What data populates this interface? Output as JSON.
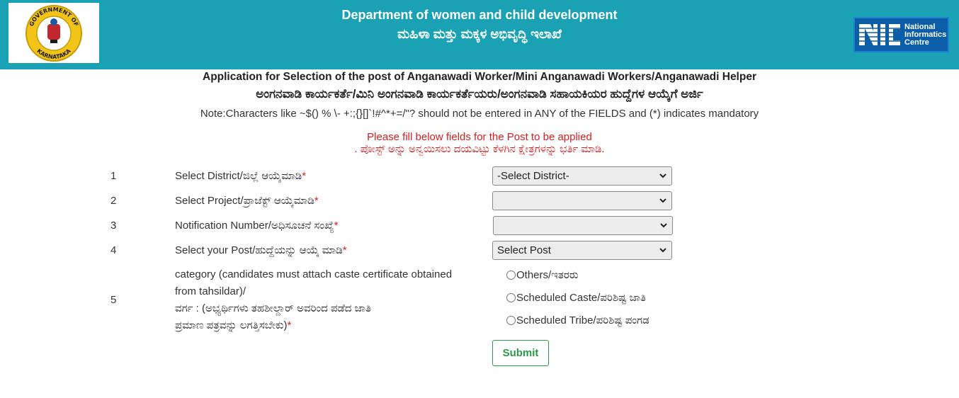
{
  "header": {
    "title_en": "Department of women and child development",
    "title_kn": "ಮಹಿಳಾ ಮತ್ತು ಮಕ್ಕಳ ಅಭಿವೃದ್ಧಿ ಇಲಾಖೆ",
    "logo_top_text": "GOVERNMENT OF",
    "logo_bottom_text": "KARNATAKA",
    "nic_text": "National\nInformatics\nCentre",
    "bg_color": "#1aa1b4"
  },
  "page": {
    "title_en": "Application for Selection of the post of Anganawadi Worker/Mini Anganawadi Workers/Anganawadi Helper",
    "title_kn": "ಅಂಗನವಾಡಿ ಕಾರ್ಯಕರ್ತೆ/ಮಿನಿ ಅಂಗನವಾಡಿ ಕಾರ್ಯಕರ್ತೆಯರು/ಅಂಗನವಾಡಿ ಸಹಾಯಕಿಯರ ಹುದ್ದೆಗಳ ಆಯ್ಕೆಗೆ ಅರ್ಜಿ",
    "note": "Note:Characters like ~$() % \\- +:;{}[]`!#^*+=/\"? should not be entered in ANY of the FIELDS and (*) indicates mandatory",
    "fill_msg_en": "Please fill below fields for the Post to be applied",
    "fill_msg_kn": ". ಪೋಸ್ಟ್ ಅನ್ನು ಅನ್ವಯಿಸಲು ದಯವಿಟ್ಟು ಕೆಳಗಿನ ಕ್ಷೇತ್ರಗಳನ್ನು ಭರ್ತಿ ಮಾಡಿ."
  },
  "form": {
    "required_marker": "*",
    "rows": [
      {
        "num": "1",
        "label": "Select District/ಜಿಲ್ಲೆ ಆಯ್ಕೆಮಾಡಿ",
        "value": "-Select District-"
      },
      {
        "num": "2",
        "label": "Select Project/ಪ್ರಾಜೆಕ್ಟ್ ಆಯ್ಕೆಮಾಡಿ",
        "value": ""
      },
      {
        "num": "3",
        "label": "Notification Number/ಅಧಿಸೂಚನೆ ಸಂಖ್ಯೆ",
        "value": ""
      },
      {
        "num": "4",
        "label": "Select your Post/ಹುದ್ದೆಯನ್ನು ಆಯ್ಕೆ ಮಾಡಿ",
        "value": "Select Post"
      }
    ],
    "category": {
      "num": "5",
      "label_lines": [
        "category (candidates must attach caste certificate obtained",
        "from tahsildar)/",
        "ವರ್ಗ : (ಅಭ್ಯರ್ಥಿಗಳು ತಹಶೀಲ್ದಾರ್ ಅವರಿಂದ ಪಡೆದ ಜಾತಿ",
        "ಪ್ರಮಾಣ ಪತ್ರವನ್ನು ಲಗತ್ತಿಸಬೇಕು)"
      ],
      "options": [
        "Others/ಇತರರು",
        "Scheduled Caste/ಪರಿಶಿಷ್ಟ ಜಾತಿ",
        "Scheduled Tribe/ಪರಿಶಿಷ್ಟ ಪಂಗಡ"
      ]
    },
    "submit_label": "Submit"
  }
}
